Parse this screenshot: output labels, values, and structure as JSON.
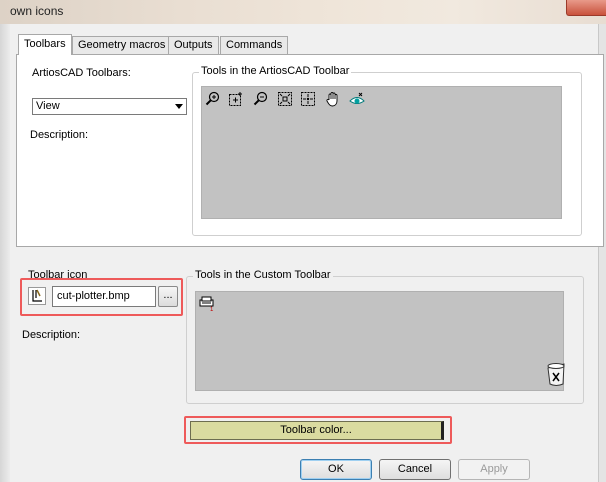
{
  "window": {
    "title": "own icons"
  },
  "tabs": [
    {
      "label": "Toolbars"
    },
    {
      "label": "Geometry macros"
    },
    {
      "label": "Outputs"
    },
    {
      "label": "Commands"
    }
  ],
  "toolbars": {
    "toolbars_label": "ArtiosCAD Toolbars:",
    "selected_toolbar": "View",
    "description_label": "Description:",
    "tools_group_title": "Tools in the ArtiosCAD Toolbar",
    "tool_icons": [
      "zoom-in-icon",
      "zoom-box-icon",
      "zoom-out-icon",
      "zoom-fit-icon",
      "zoom-extents-icon",
      "pan-hand-icon",
      "view-eye-icon"
    ]
  },
  "custom": {
    "icon_group_title": "Toolbar icon",
    "icon_file": "cut-plotter.bmp",
    "browse_label": "...",
    "description_label": "Description:",
    "tools_group_title": "Tools in the Custom Toolbar",
    "toolbar_color_label": "Toolbar color...",
    "toolbar_color": "#dadba0"
  },
  "buttons": {
    "ok": "OK",
    "cancel": "Cancel",
    "apply": "Apply"
  },
  "colors": {
    "highlight": "#ee5a5a",
    "tool_area": "#c2c2c2"
  }
}
